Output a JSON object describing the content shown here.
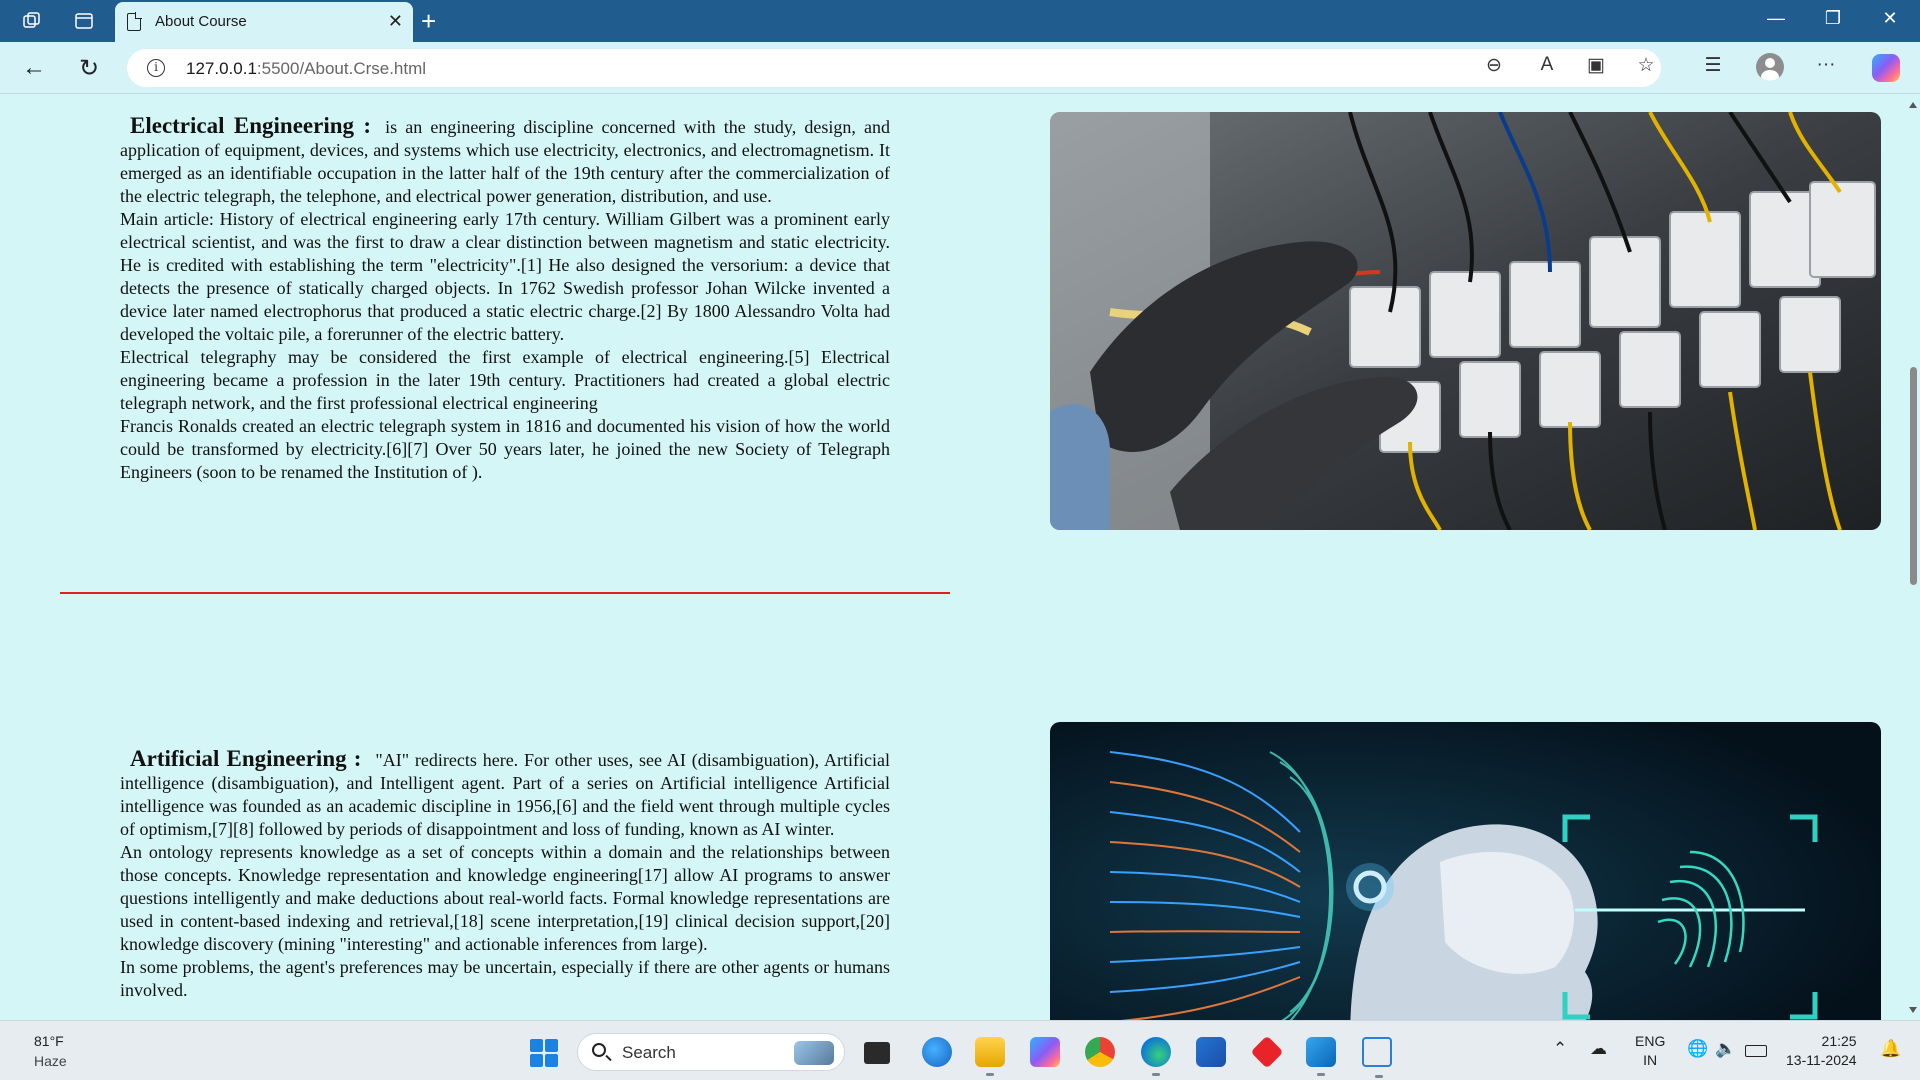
{
  "browser": {
    "tab_title": "About Course",
    "url_host": "127.0.0.1",
    "url_path": ":5500/About.Crse.html",
    "close_glyph": "✕",
    "new_tab_glyph": "+"
  },
  "section_electrical": {
    "heading": "Electrical Engineering :",
    "intro": "is an engineering discipline concerned with the study, design, and application of equipment, devices, and systems which use electricity, electronics, and electromagnetism. It emerged as an identifiable occupation in the latter half of the 19th century after the commercialization of the electric telegraph, the telephone, and electrical power generation, distribution, and use.",
    "para2": "Main article: History of electrical engineering early 17th century. William Gilbert was a prominent early electrical scientist, and was the first to draw a clear distinction between magnetism and static electricity. He is credited with establishing the term \"electricity\".[1] He also designed the versorium: a device that detects the presence of statically charged objects. In 1762 Swedish professor Johan Wilcke invented a device later named electrophorus that produced a static electric charge.[2] By 1800 Alessandro Volta had developed the voltaic pile, a forerunner of the electric battery.",
    "para3": "Electrical telegraphy may be considered the first example of electrical engineering.[5] Electrical engineering became a profession in the later 19th century. Practitioners had created a global electric telegraph network, and the first professional electrical engineering",
    "para4": "Francis Ronalds created an electric telegraph system in 1816 and documented his vision of how the world could be transformed by electricity.[6][7] Over 50 years later, he joined the new Society of Telegraph Engineers (soon to be renamed the Institution of )."
  },
  "section_ai": {
    "heading": "Artificial Engineering :",
    "intro": "\"AI\" redirects here. For other uses, see AI (disambiguation), Artificial intelligence (disambiguation), and Intelligent agent. Part of a series on Artificial intelligence Artificial intelligence was founded as an academic discipline in 1956,[6] and the field went through multiple cycles of optimism,[7][8] followed by periods of disappointment and loss of funding, known as AI winter.",
    "para2": "An ontology represents knowledge as a set of concepts within a domain and the relationships between those concepts. Knowledge representation and knowledge engineering[17] allow AI programs to answer questions intelligently and make deductions about real-world facts. Formal knowledge representations are used in content-based indexing and retrieval,[18] scene interpretation,[19] clinical decision support,[20] knowledge discovery (mining \"interesting\" and actionable inferences from large).",
    "para3": "In some problems, the agent's preferences may be uncertain, especially if there are other agents or humans involved."
  },
  "taskbar": {
    "temperature": "81°F",
    "condition": "Haze",
    "search_label": "Search",
    "lang_primary": "ENG",
    "lang_secondary": "IN",
    "time": "21:25",
    "date": "13-11-2024"
  },
  "colors": {
    "page_background": "#d4f6f6",
    "divider": "#e02020",
    "tabbar": "#215c8f"
  }
}
